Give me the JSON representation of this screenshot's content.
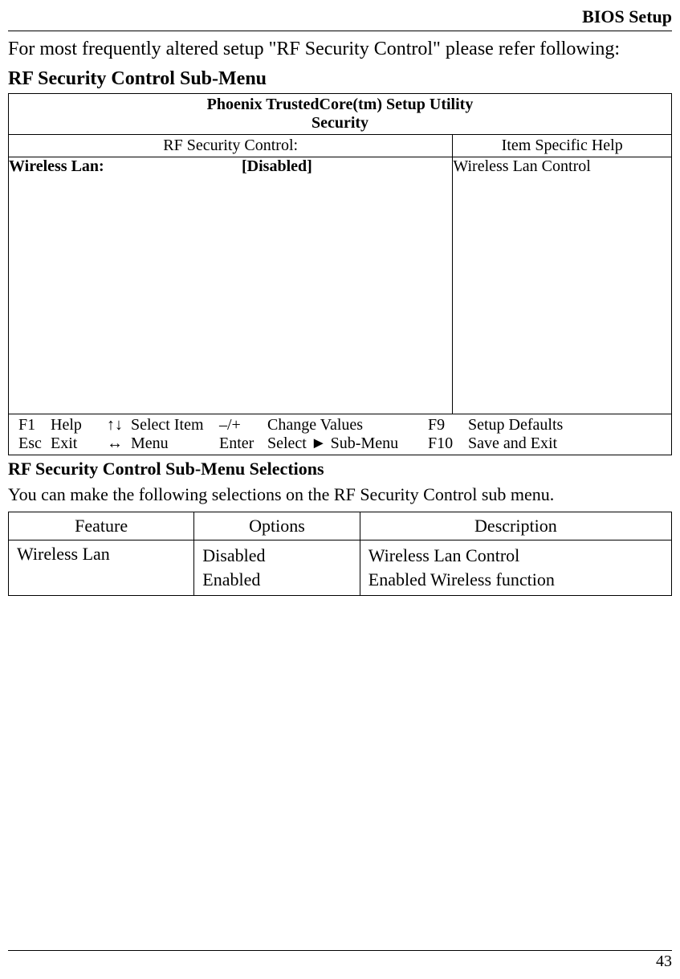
{
  "header": {
    "title": "BIOS Setup"
  },
  "intro": "For most frequently altered setup \"RF Security Control\" please refer following:",
  "submenu_heading": "RF Security Control Sub-Menu",
  "bios": {
    "utility_title": "Phoenix TrustedCore(tm) Setup Utility",
    "utility_sub": "Security",
    "section_left": "RF Security Control:",
    "section_right": "Item Specific Help",
    "option_label": "Wireless Lan:",
    "option_value": "[Disabled]",
    "help_text": "Wireless Lan Control",
    "footer": {
      "f1_key": "F1",
      "f1_label": "Help",
      "arrows_ud": "↑↓",
      "select_item": "Select Item",
      "minus_plus": "–/+",
      "change_values": "Change Values",
      "f9_key": "F9",
      "f9_label": "Setup Defaults",
      "esc_key": "Esc",
      "esc_label": "Exit",
      "arrows_lr": "↔",
      "menu": "Menu",
      "enter_key": "Enter",
      "select_submenu": "Select ► Sub-Menu",
      "f10_key": "F10",
      "f10_label": "Save and Exit"
    }
  },
  "selections_heading": "RF Security Control Sub-Menu Selections",
  "selections_intro": "You can make the following selections on the RF Security Control sub menu.",
  "sel_table": {
    "head_feature": "Feature",
    "head_options": "Options",
    "head_description": "Description",
    "row_feature": "Wireless Lan",
    "row_opt1": "Disabled",
    "row_opt2": "Enabled",
    "row_desc1": "Wireless Lan Control",
    "row_desc2": "Enabled Wireless function"
  },
  "page_number": "43"
}
